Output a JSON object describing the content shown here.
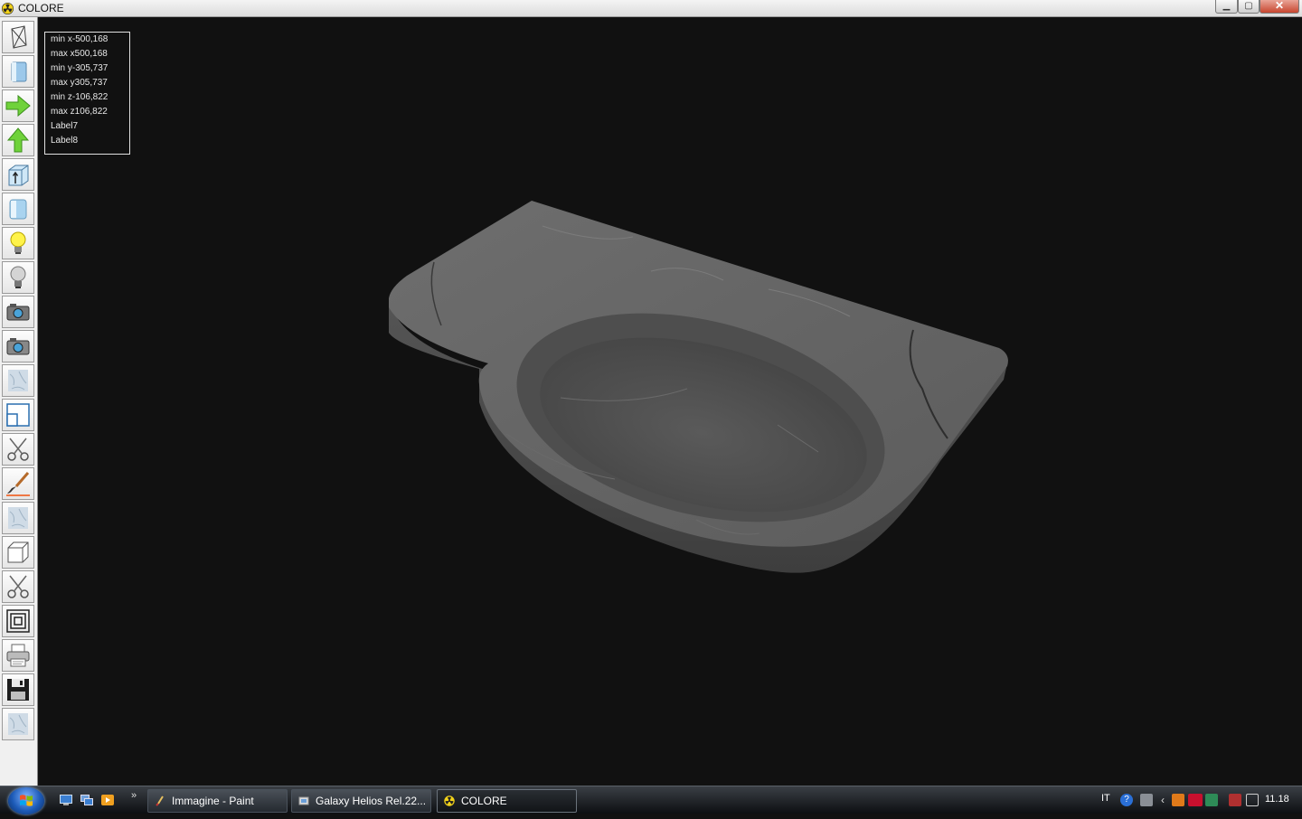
{
  "window": {
    "title": "COLORE",
    "minimize": "▁",
    "maximize": "▢",
    "close": "✕"
  },
  "toolbar": {
    "tools": [
      {
        "name": "wireframe-tool",
        "icon": "wireframe-box-icon"
      },
      {
        "name": "solid-tool",
        "icon": "solid-box-icon"
      },
      {
        "name": "rotate-right-tool",
        "icon": "arrow-right-icon"
      },
      {
        "name": "rotate-up-tool",
        "icon": "arrow-up-icon"
      },
      {
        "name": "top-view-tool",
        "icon": "box-arrow-icon"
      },
      {
        "name": "front-view-tool",
        "icon": "cylinder-icon"
      },
      {
        "name": "light-on-tool",
        "icon": "lightbulb-on-icon"
      },
      {
        "name": "light-off-tool",
        "icon": "lightbulb-off-icon"
      },
      {
        "name": "camera-tool",
        "icon": "camera-icon"
      },
      {
        "name": "camera2-tool",
        "icon": "camera-icon"
      },
      {
        "name": "texture-tool",
        "icon": "marble-texture-icon"
      },
      {
        "name": "window-tool",
        "icon": "window-icon"
      },
      {
        "name": "cut-tool",
        "icon": "scissors-icon"
      },
      {
        "name": "paint-tool",
        "icon": "brush-icon"
      },
      {
        "name": "texture2-tool",
        "icon": "marble-texture-icon"
      },
      {
        "name": "cube-tool",
        "icon": "cube-icon"
      },
      {
        "name": "cut2-tool",
        "icon": "scissors-icon"
      },
      {
        "name": "frames-tool",
        "icon": "nested-squares-icon"
      },
      {
        "name": "print-tool",
        "icon": "printer-icon"
      },
      {
        "name": "save-tool",
        "icon": "floppy-disk-icon"
      },
      {
        "name": "texture3-tool",
        "icon": "marble-texture-icon"
      }
    ]
  },
  "info": {
    "lines": [
      "min x-500,168",
      "max x500,168",
      "min y-305,737",
      "max y305,737",
      "min z-106,822",
      "max z106,822",
      "Label7",
      "Label8"
    ]
  },
  "taskbar": {
    "quicklaunch_more": "»",
    "tasks": [
      {
        "label": "Immagine - Paint",
        "active": false
      },
      {
        "label": "Galaxy Helios  Rel.22...",
        "active": false
      },
      {
        "label": "COLORE",
        "active": true
      }
    ],
    "language": "IT",
    "clock": "11.18"
  },
  "colors": {
    "accent": "#1d5bb8",
    "marble": "#7a7a7a",
    "viewport_bg": "#111111"
  }
}
